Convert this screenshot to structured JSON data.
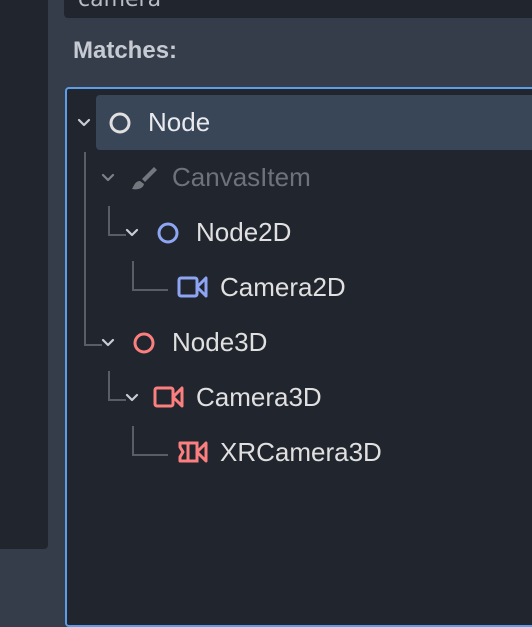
{
  "search": {
    "value": "camera"
  },
  "matches_label": "Matches:",
  "tree": {
    "items": [
      {
        "label": "Node",
        "icon": "circle-icon",
        "color": "#e0e0e0",
        "selected": true
      },
      {
        "label": "CanvasItem",
        "icon": "brush-icon",
        "color": "#6e737b",
        "disabled": true
      },
      {
        "label": "Node2D",
        "icon": "circle-icon",
        "color": "#8da5f3"
      },
      {
        "label": "Camera2D",
        "icon": "camera-icon",
        "color": "#8da5f3"
      },
      {
        "label": "Node3D",
        "icon": "circle-icon",
        "color": "#fc7f7f"
      },
      {
        "label": "Camera3D",
        "icon": "camera-icon",
        "color": "#fc7f7f"
      },
      {
        "label": "XRCamera3D",
        "icon": "xr-camera-icon",
        "color": "#fc7f7f"
      }
    ]
  },
  "colors": {
    "accent": "#5d9ce6",
    "text": "#e0e0e0",
    "disabled_text": "#6e737b"
  }
}
